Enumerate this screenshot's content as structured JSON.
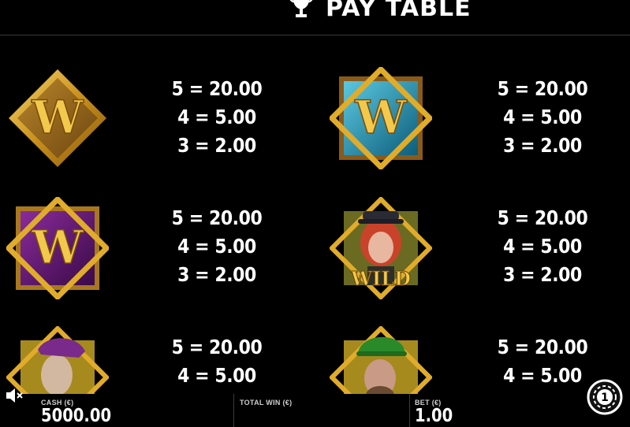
{
  "header": {
    "title": "PAY TABLE",
    "icon": "trophy-icon"
  },
  "symbols": [
    {
      "name": "gold-w-symbol",
      "letter": "W",
      "pays": [
        "5 = 20.00",
        "4 = 5.00",
        "3 = 2.00"
      ]
    },
    {
      "name": "blue-w-symbol",
      "letter": "W",
      "pays": [
        "5 = 20.00",
        "4 = 5.00",
        "3 = 2.00"
      ]
    },
    {
      "name": "purple-w-symbol",
      "letter": "W",
      "pays": [
        "5 = 20.00",
        "4 = 5.00",
        "3 = 2.00"
      ]
    },
    {
      "name": "wild-redhead-symbol",
      "letter": "WILD",
      "pays": [
        "5 = 20.00",
        "4 = 5.00",
        "3 = 2.00"
      ]
    },
    {
      "name": "purple-hat-man-symbol",
      "pays": [
        "5 = 20.00",
        "4 = 5.00"
      ]
    },
    {
      "name": "green-hat-man-symbol",
      "pays": [
        "5 = 20.00",
        "4 = 5.00"
      ]
    }
  ],
  "bottombar": {
    "cash_label": "CASH (€)",
    "cash_value": "5000.00",
    "total_win_label": "TOTAL WIN (€)",
    "bet_label": "BET (€)",
    "bet_value": "1.00"
  },
  "colors": {
    "background": "#000000",
    "gold": "#d9a520",
    "blue": "#1e8fb0",
    "purple": "#5a1a6a"
  }
}
